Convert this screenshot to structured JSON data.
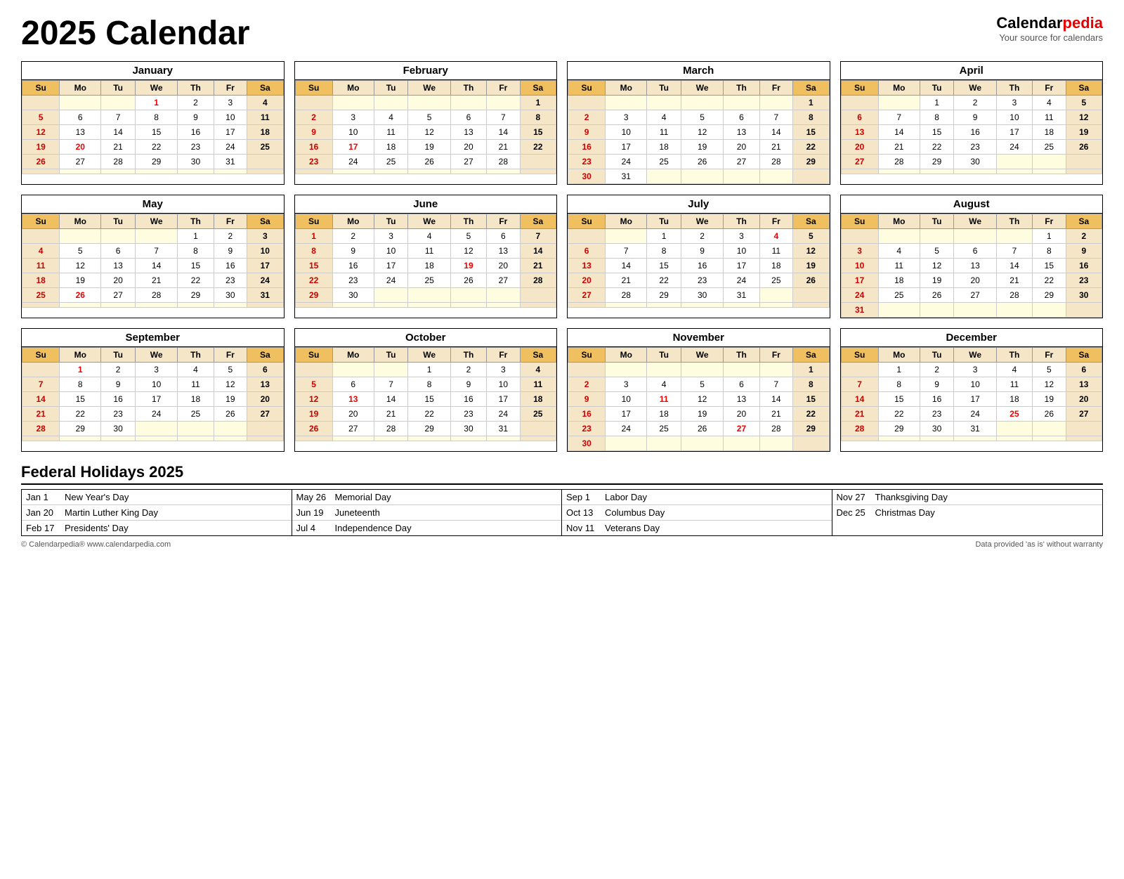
{
  "title": "2025 Calendar",
  "brand": {
    "name1": "Calendar",
    "name2": "pedia",
    "tagline": "Your source for calendars"
  },
  "months": [
    {
      "name": "January",
      "weeks": [
        [
          "",
          "",
          "",
          "1*",
          "2",
          "3",
          "4"
        ],
        [
          "5",
          "6",
          "7",
          "8",
          "9",
          "10",
          "11"
        ],
        [
          "12",
          "13",
          "14",
          "15",
          "16",
          "17",
          "18"
        ],
        [
          "19",
          "20*",
          "21",
          "22",
          "23",
          "24",
          "25"
        ],
        [
          "26",
          "27",
          "28",
          "29",
          "30",
          "31",
          ""
        ]
      ],
      "extraRow": true
    },
    {
      "name": "February",
      "weeks": [
        [
          "",
          "",
          "",
          "",
          "",
          "",
          "1"
        ],
        [
          "2",
          "3",
          "4",
          "5",
          "6",
          "7",
          "8"
        ],
        [
          "9",
          "10",
          "11",
          "12",
          "13",
          "14",
          "15"
        ],
        [
          "16",
          "17*",
          "18",
          "19",
          "20",
          "21",
          "22"
        ],
        [
          "23",
          "24",
          "25",
          "26",
          "27",
          "28",
          ""
        ]
      ],
      "extraRow": true
    },
    {
      "name": "March",
      "weeks": [
        [
          "",
          "",
          "",
          "",
          "",
          "",
          "1"
        ],
        [
          "2",
          "3",
          "4",
          "5",
          "6",
          "7",
          "8"
        ],
        [
          "9",
          "10",
          "11",
          "12",
          "13",
          "14",
          "15"
        ],
        [
          "16",
          "17",
          "18",
          "19",
          "20",
          "21",
          "22"
        ],
        [
          "23",
          "24",
          "25",
          "26",
          "27",
          "28",
          "29"
        ],
        [
          "30",
          "31",
          "",
          "",
          "",
          "",
          ""
        ]
      ],
      "extraRow": false
    },
    {
      "name": "April",
      "weeks": [
        [
          "",
          "",
          "1",
          "2",
          "3",
          "4",
          "5"
        ],
        [
          "6",
          "7",
          "8",
          "9",
          "10",
          "11",
          "12"
        ],
        [
          "13",
          "14",
          "15",
          "16",
          "17",
          "18",
          "19"
        ],
        [
          "20",
          "21",
          "22",
          "23",
          "24",
          "25",
          "26"
        ],
        [
          "27",
          "28",
          "29",
          "30",
          "",
          "",
          ""
        ]
      ],
      "extraRow": true
    },
    {
      "name": "May",
      "weeks": [
        [
          "",
          "",
          "",
          "",
          "1",
          "2",
          "3"
        ],
        [
          "4",
          "5",
          "6",
          "7",
          "8",
          "9",
          "10"
        ],
        [
          "11",
          "12",
          "13",
          "14",
          "15",
          "16",
          "17"
        ],
        [
          "18",
          "19",
          "20",
          "21",
          "22",
          "23",
          "24"
        ],
        [
          "25",
          "26*",
          "27",
          "28",
          "29",
          "30",
          "31"
        ]
      ],
      "extraRow": true
    },
    {
      "name": "June",
      "weeks": [
        [
          "1",
          "2",
          "3",
          "4",
          "5",
          "6",
          "7"
        ],
        [
          "8",
          "9",
          "10",
          "11",
          "12",
          "13",
          "14"
        ],
        [
          "15",
          "16",
          "17",
          "18",
          "19*",
          "20",
          "21"
        ],
        [
          "22",
          "23",
          "24",
          "25",
          "26",
          "27",
          "28"
        ],
        [
          "29",
          "30",
          "",
          "",
          "",
          "",
          ""
        ]
      ],
      "extraRow": true
    },
    {
      "name": "July",
      "weeks": [
        [
          "",
          "",
          "1",
          "2",
          "3",
          "4*",
          "5"
        ],
        [
          "6",
          "7",
          "8",
          "9",
          "10",
          "11",
          "12"
        ],
        [
          "13",
          "14",
          "15",
          "16",
          "17",
          "18",
          "19"
        ],
        [
          "20",
          "21",
          "22",
          "23",
          "24",
          "25",
          "26"
        ],
        [
          "27",
          "28",
          "29",
          "30",
          "31",
          "",
          ""
        ]
      ],
      "extraRow": true
    },
    {
      "name": "August",
      "weeks": [
        [
          "",
          "",
          "",
          "",
          "",
          "1",
          "2"
        ],
        [
          "3",
          "4",
          "5",
          "6",
          "7",
          "8",
          "9"
        ],
        [
          "10",
          "11",
          "12",
          "13",
          "14",
          "15",
          "16"
        ],
        [
          "17",
          "18",
          "19",
          "20",
          "21",
          "22",
          "23"
        ],
        [
          "24",
          "25",
          "26",
          "27",
          "28",
          "29",
          "30"
        ],
        [
          "31",
          "",
          "",
          "",
          "",
          "",
          ""
        ]
      ],
      "extraRow": false
    },
    {
      "name": "September",
      "weeks": [
        [
          "",
          "1*",
          "2",
          "3",
          "4",
          "5",
          "6"
        ],
        [
          "7",
          "8",
          "9",
          "10",
          "11",
          "12",
          "13"
        ],
        [
          "14",
          "15",
          "16",
          "17",
          "18",
          "19",
          "20"
        ],
        [
          "21",
          "22",
          "23",
          "24",
          "25",
          "26",
          "27"
        ],
        [
          "28",
          "29",
          "30",
          "",
          "",
          "",
          ""
        ]
      ],
      "extraRow": true
    },
    {
      "name": "October",
      "weeks": [
        [
          "",
          "",
          "",
          "1",
          "2",
          "3",
          "4"
        ],
        [
          "5",
          "6",
          "7",
          "8",
          "9",
          "10",
          "11"
        ],
        [
          "12",
          "13*",
          "14",
          "15",
          "16",
          "17",
          "18"
        ],
        [
          "19",
          "20",
          "21",
          "22",
          "23",
          "24",
          "25"
        ],
        [
          "26",
          "27",
          "28",
          "29",
          "30",
          "31",
          ""
        ]
      ],
      "extraRow": true
    },
    {
      "name": "November",
      "weeks": [
        [
          "",
          "",
          "",
          "",
          "",
          "",
          "1"
        ],
        [
          "2",
          "3",
          "4",
          "5",
          "6",
          "7",
          "8"
        ],
        [
          "9",
          "10",
          "11*",
          "12",
          "13",
          "14",
          "15"
        ],
        [
          "16",
          "17",
          "18",
          "19",
          "20",
          "21",
          "22"
        ],
        [
          "23",
          "24",
          "25",
          "26",
          "27*",
          "28",
          "29"
        ],
        [
          "30",
          "",
          "",
          "",
          "",
          "",
          ""
        ]
      ],
      "extraRow": false
    },
    {
      "name": "December",
      "weeks": [
        [
          "",
          "1",
          "2",
          "3",
          "4",
          "5",
          "6"
        ],
        [
          "7",
          "8",
          "9",
          "10",
          "11",
          "12",
          "13"
        ],
        [
          "14",
          "15",
          "16",
          "17",
          "18",
          "19",
          "20"
        ],
        [
          "21",
          "22",
          "23",
          "24",
          "25*",
          "26",
          "27"
        ],
        [
          "28",
          "29",
          "30",
          "31",
          "",
          "",
          ""
        ]
      ],
      "extraRow": true
    }
  ],
  "weekdays": [
    "Su",
    "Mo",
    "Tu",
    "We",
    "Th",
    "Fr",
    "Sa"
  ],
  "holidays": {
    "title": "Federal Holidays 2025",
    "columns": [
      [
        {
          "date": "Jan 1",
          "name": "New Year's Day"
        },
        {
          "date": "Jan 20",
          "name": "Martin Luther King Day"
        },
        {
          "date": "Feb 17",
          "name": "Presidents' Day"
        }
      ],
      [
        {
          "date": "May 26",
          "name": "Memorial Day"
        },
        {
          "date": "Jun 19",
          "name": "Juneteenth"
        },
        {
          "date": "Jul 4",
          "name": "Independence Day"
        }
      ],
      [
        {
          "date": "Sep 1",
          "name": "Labor Day"
        },
        {
          "date": "Oct 13",
          "name": "Columbus Day"
        },
        {
          "date": "Nov 11",
          "name": "Veterans Day"
        }
      ],
      [
        {
          "date": "Nov 27",
          "name": "Thanksgiving Day"
        },
        {
          "date": "Dec 25",
          "name": "Christmas Day"
        }
      ]
    ]
  },
  "footer": {
    "copyright": "© Calendarpedia®  www.calendarpedia.com",
    "disclaimer": "Data provided 'as is' without warranty"
  }
}
